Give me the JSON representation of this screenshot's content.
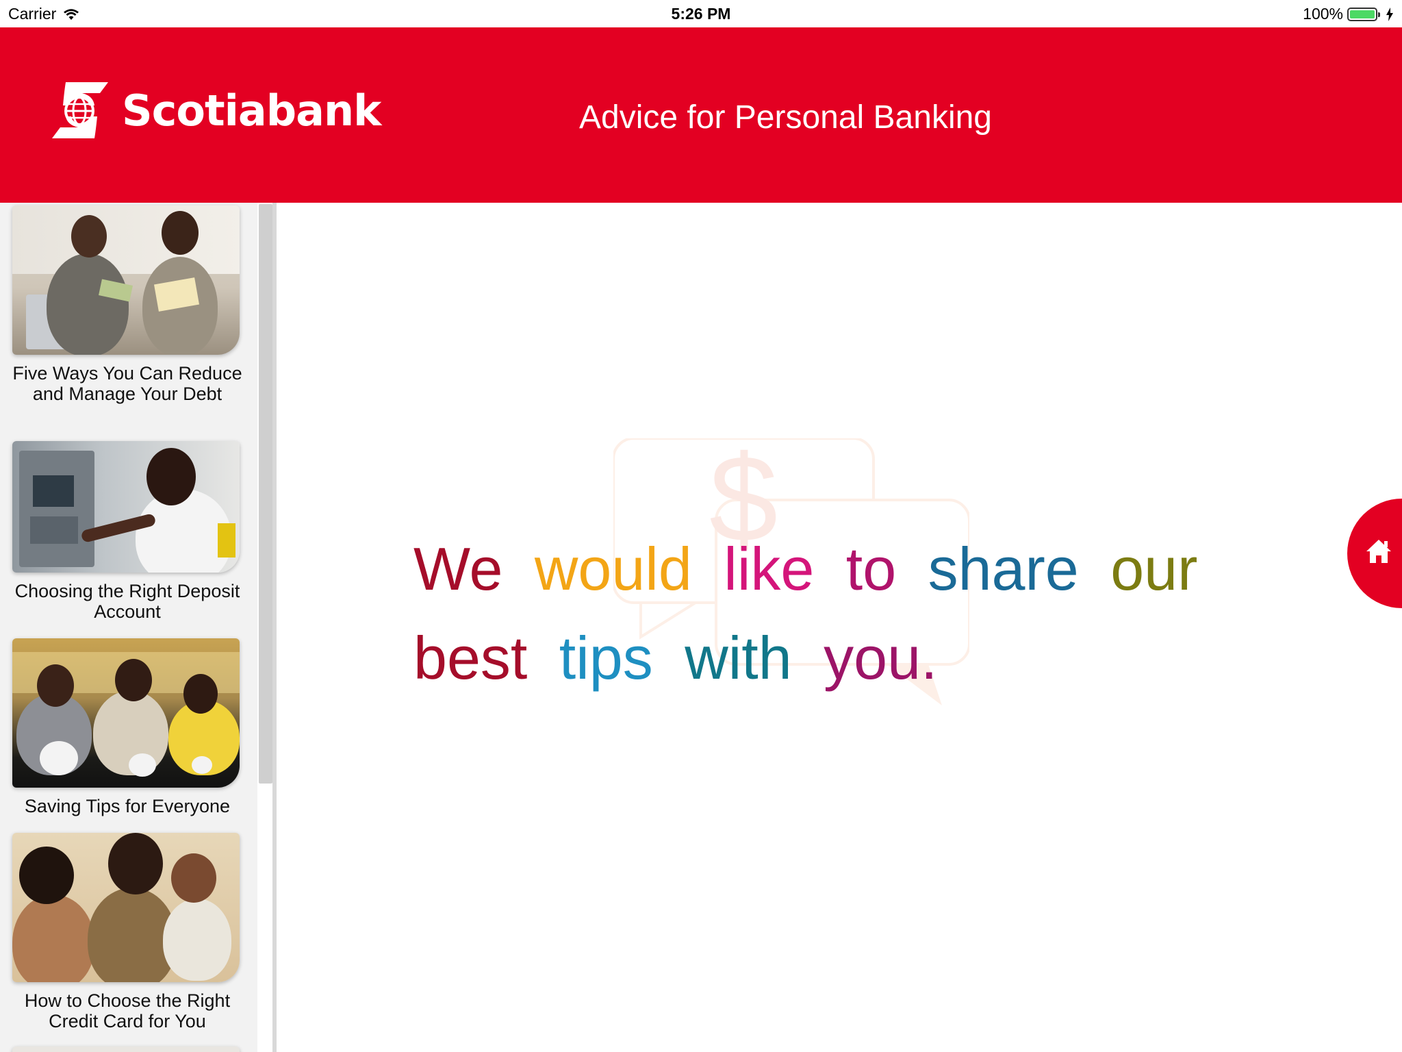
{
  "status_bar": {
    "carrier": "Carrier",
    "time": "5:26 PM",
    "battery": "100%",
    "wifi_icon": "wifi-icon",
    "battery_icon": "battery-icon",
    "charging_icon": "bolt-icon"
  },
  "header": {
    "brand": "Scotiabank",
    "title": "Advice for Personal Banking",
    "brand_color": "#e30022"
  },
  "sidebar": {
    "items": [
      {
        "label": "Five Ways You Can Reduce and Manage Your Debt"
      },
      {
        "label": "Choosing the Right Deposit Account"
      },
      {
        "label": "Saving Tips for Everyone"
      },
      {
        "label": "How to Choose the Right Credit Card for You"
      }
    ]
  },
  "main": {
    "headline_words": [
      {
        "text": "We",
        "color": "#a50d2a"
      },
      {
        "text": "would",
        "color": "#f3a516"
      },
      {
        "text": "like",
        "color": "#d4157a"
      },
      {
        "text": "to",
        "color": "#b0136b"
      },
      {
        "text": "share",
        "color": "#1a6a97"
      },
      {
        "text": "our",
        "color": "#7c7c12"
      },
      {
        "text": "best",
        "color": "#a50d2a"
      },
      {
        "text": "tips",
        "color": "#1e8fc1"
      },
      {
        "text": "with",
        "color": "#11778a"
      },
      {
        "text": "you.",
        "color": "#9c1467"
      }
    ],
    "background_icon": "dollar-speech-bubble-icon"
  },
  "home_button": {
    "icon": "home-icon"
  }
}
